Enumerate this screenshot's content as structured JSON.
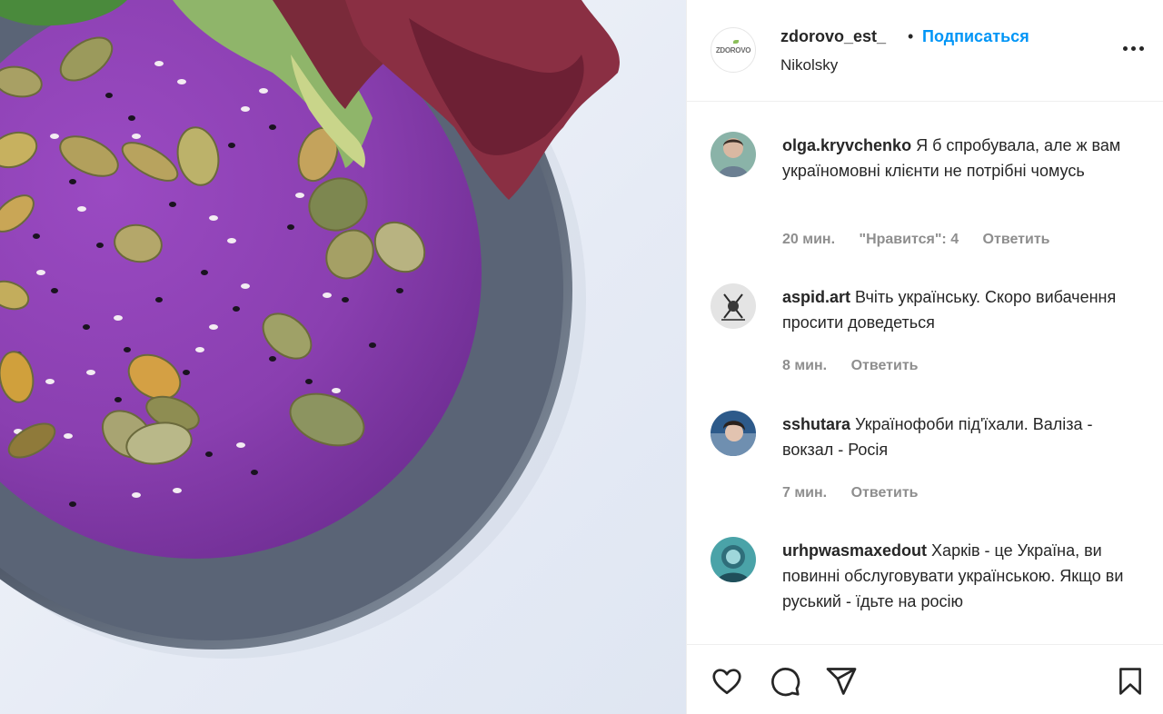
{
  "post": {
    "author": {
      "username": "zdorovo_est_",
      "location": "Nikolsky",
      "avatar_text": "ZDOROVO"
    },
    "follow_label": "Подписаться",
    "separator": "•",
    "photo_icon": "purple-soup-bowl-photo"
  },
  "comments": [
    {
      "username": "olga.kryvchenko",
      "text": "Я б спробувала, але ж вам україномовні клієнти не потрібні чомусь",
      "time": "20 мин.",
      "likes": "\"Нравится\": 4",
      "reply_label": "Ответить"
    },
    {
      "username": "aspid.art",
      "text": "Вчіть українську. Скоро вибачення просити доведеться",
      "time": "8 мин.",
      "reply_label": "Ответить"
    },
    {
      "username": "sshutara",
      "text": "Українофоби під'їхали. Валіза - вокзал - Росія",
      "time": "7 мин.",
      "reply_label": "Ответить"
    },
    {
      "username": "urhpwasmaxedout",
      "text": "Харків - це Україна, ви повинні обслуговувати українською. Якщо ви руський - їдьте на росію"
    }
  ],
  "actions": {
    "like_icon": "heart-icon",
    "comment_icon": "comment-bubble-icon",
    "share_icon": "paper-plane-icon",
    "save_icon": "bookmark-icon"
  },
  "colors": {
    "accent": "#0095f6",
    "text": "#262626",
    "muted": "#8e8e8e",
    "border": "#efefef",
    "soup": "#8a3fb0"
  }
}
